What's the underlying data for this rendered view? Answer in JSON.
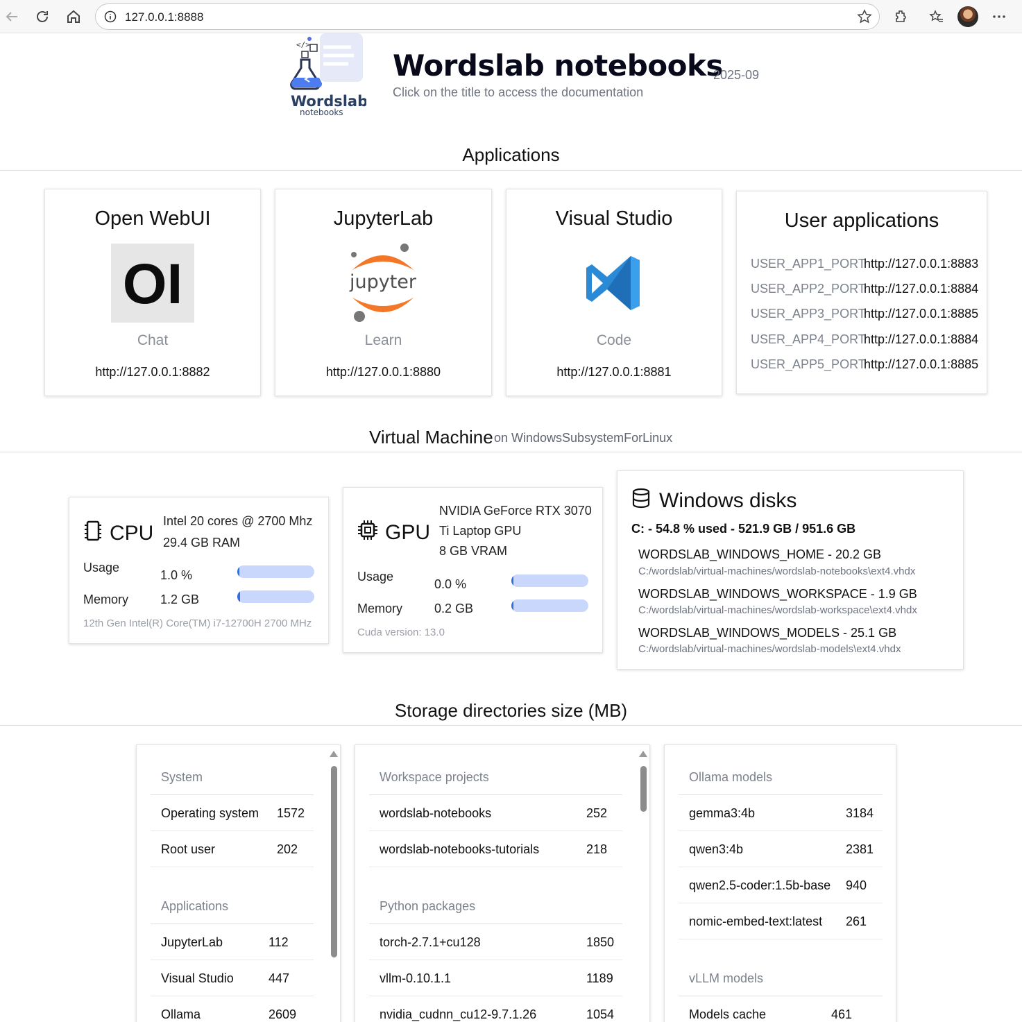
{
  "browser": {
    "url": "127.0.0.1:8888"
  },
  "header": {
    "title": "Wordslab notebooks",
    "version": "2025-09",
    "subtitle": "Click on the title to access the documentation",
    "logo_text": "Wordslab",
    "logo_sub": "notebooks"
  },
  "applications": {
    "section_title": "Applications",
    "cards": [
      {
        "title": "Open WebUI",
        "label": "Chat",
        "url": "http://127.0.0.1:8882",
        "icon": "open-webui-logo",
        "icon_text": "OI"
      },
      {
        "title": "JupyterLab",
        "label": "Learn",
        "url": "http://127.0.0.1:8880",
        "icon": "jupyter-logo",
        "icon_text": "jupyter"
      },
      {
        "title": "Visual Studio",
        "label": "Code",
        "url": "http://127.0.0.1:8881",
        "icon": "vscode-logo"
      }
    ],
    "user_apps": {
      "title": "User applications",
      "rows": [
        {
          "name": "USER_APP1_PORT",
          "url": "http://127.0.0.1:8883"
        },
        {
          "name": "USER_APP2_PORT",
          "url": "http://127.0.0.1:8884"
        },
        {
          "name": "USER_APP3_PORT",
          "url": "http://127.0.0.1:8885"
        },
        {
          "name": "USER_APP4_PORT",
          "url": "http://127.0.0.1:8884"
        },
        {
          "name": "USER_APP5_PORT",
          "url": "http://127.0.0.1:8885"
        }
      ]
    }
  },
  "vm": {
    "section_title": "Virtual Machine",
    "section_sub": "on WindowsSubsystemForLinux",
    "cpu": {
      "title": "CPU",
      "info1": "Intel 20 cores @ 2700 Mhz",
      "info2": "29.4 GB RAM",
      "usage_label": "Usage",
      "usage_value": "1.0 %",
      "usage_fraction": 0.01,
      "memory_label": "Memory",
      "memory_value": "1.2 GB",
      "memory_fraction": 0.04,
      "footer": "12th Gen Intel(R) Core(TM) i7-12700H 2700 MHz"
    },
    "gpu": {
      "title": "GPU",
      "info1": "NVIDIA GeForce RTX 3070",
      "info2": "Ti Laptop GPU",
      "info3": "8 GB VRAM",
      "usage_label": "Usage",
      "usage_value": "0.0 %",
      "usage_fraction": 0.0,
      "memory_label": "Memory",
      "memory_value": "0.2 GB",
      "memory_fraction": 0.025,
      "footer": "Cuda version: 13.0"
    },
    "disks": {
      "title": "Windows disks",
      "summary": "C: - 54.8 % used - 521.9 GB / 951.6 GB",
      "items": [
        {
          "name": "WORDSLAB_WINDOWS_HOME - 20.2 GB",
          "path": "C:/wordslab/virtual-machines/wordslab-notebooks\\ext4.vhdx"
        },
        {
          "name": "WORDSLAB_WINDOWS_WORKSPACE - 1.9 GB",
          "path": "C:/wordslab/virtual-machines/wordslab-workspace\\ext4.vhdx"
        },
        {
          "name": "WORDSLAB_WINDOWS_MODELS - 25.1 GB",
          "path": "C:/wordslab/virtual-machines/wordslab-models\\ext4.vhdx"
        }
      ]
    }
  },
  "storage": {
    "section_title": "Storage directories size (MB)",
    "col1": {
      "groups": [
        {
          "title": "System",
          "rows": [
            {
              "name": "Operating system",
              "size": "1572"
            },
            {
              "name": "Root user",
              "size": "202"
            }
          ]
        },
        {
          "title": "Applications",
          "rows": [
            {
              "name": "JupyterLab",
              "size": "112"
            },
            {
              "name": "Visual Studio",
              "size": "447"
            },
            {
              "name": "Ollama",
              "size": "2609"
            }
          ]
        }
      ]
    },
    "col2": {
      "groups": [
        {
          "title": "Workspace projects",
          "rows": [
            {
              "name": "wordslab-notebooks",
              "size": "252"
            },
            {
              "name": "wordslab-notebooks-tutorials",
              "size": "218"
            }
          ]
        },
        {
          "title": "Python packages",
          "rows": [
            {
              "name": "torch-2.7.1+cu128",
              "size": "1850"
            },
            {
              "name": "vllm-0.10.1.1",
              "size": "1189"
            },
            {
              "name": "nvidia_cudnn_cu12-9.7.1.26",
              "size": "1054"
            }
          ]
        }
      ]
    },
    "col3": {
      "groups": [
        {
          "title": "Ollama models",
          "rows": [
            {
              "name": "gemma3:4b",
              "size": "3184"
            },
            {
              "name": "qwen3:4b",
              "size": "2381"
            },
            {
              "name": "qwen2.5-coder:1.5b-base",
              "size": "940"
            },
            {
              "name": "nomic-embed-text:latest",
              "size": "261"
            }
          ]
        },
        {
          "title": "vLLM models",
          "rows": [
            {
              "name": "Models cache",
              "size": "461"
            }
          ]
        }
      ]
    }
  }
}
